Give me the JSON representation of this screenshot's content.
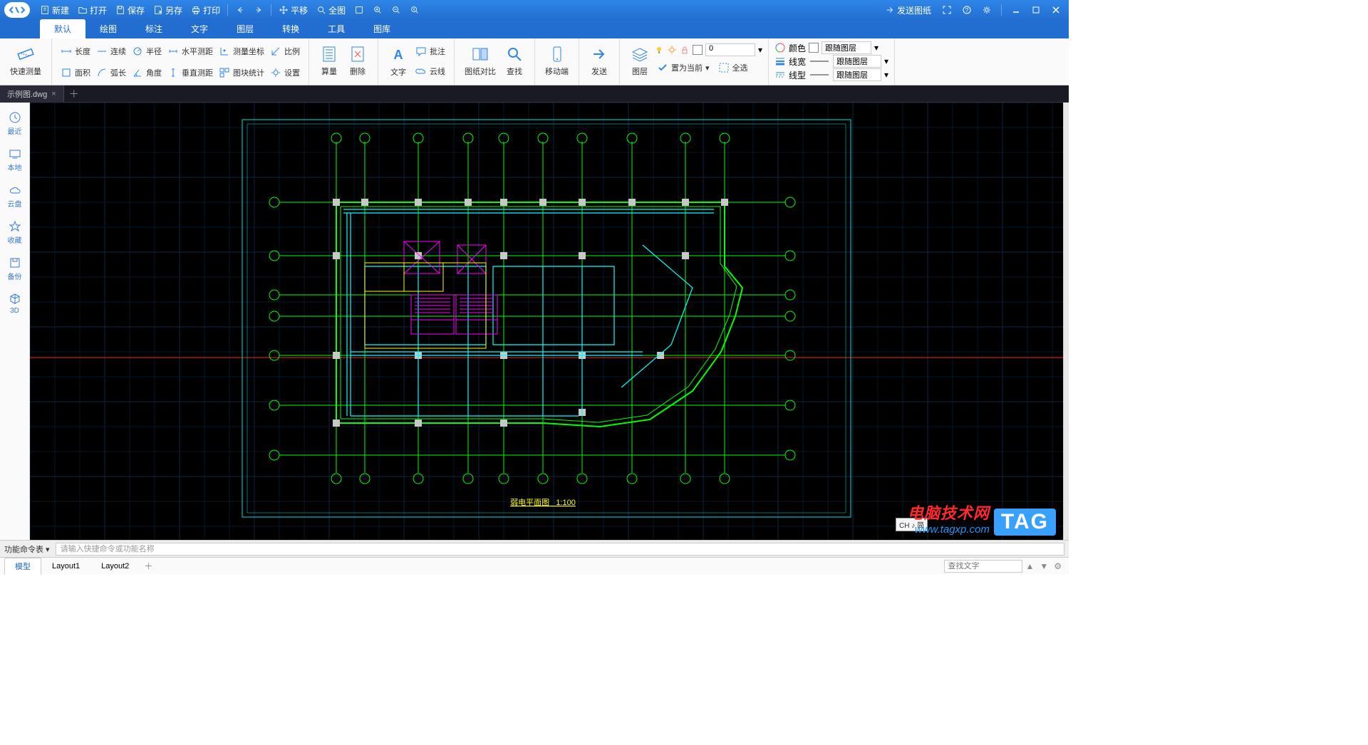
{
  "titlebar": {
    "new": "新建",
    "open": "打开",
    "save": "保存",
    "saveas": "另存",
    "print": "打印",
    "pan": "平移",
    "zoomall": "全图",
    "send_drawing": "发送图纸"
  },
  "menu": {
    "items": [
      "默认",
      "绘图",
      "标注",
      "文字",
      "图层",
      "转换",
      "工具",
      "图库"
    ],
    "active": 0
  },
  "ribbon": {
    "quick": "快速测量",
    "measure": {
      "length": "长度",
      "continuous": "连续",
      "radius": "半径",
      "hdist": "水平测距",
      "coord": "测量坐标",
      "scale": "比例",
      "area": "面积",
      "arc": "弧长",
      "angle": "角度",
      "vdist": "垂直测距",
      "blockstat": "图块统计",
      "settings": "设置"
    },
    "calc": "算量",
    "delete": "删除",
    "text": "文字",
    "annotate": "批注",
    "cloud": "云线",
    "compare": "图纸对比",
    "find": "查找",
    "mobile": "移动端",
    "send": "发送",
    "layers": "图层",
    "setcurrent": "置为当前",
    "selall": "全选",
    "props": {
      "color": "颜色",
      "weight": "线宽",
      "ltype": "线型",
      "bylayer": "跟随图层"
    },
    "counter": "0"
  },
  "doctab": {
    "name": "示例图.dwg"
  },
  "leftbar": {
    "recent": "最近",
    "local": "本地",
    "cloud": "云盘",
    "fav": "收藏",
    "backup": "备份",
    "three_d": "3D"
  },
  "drawing": {
    "title": "弱电平面图",
    "scale": "1:100"
  },
  "ime": "CH ♪ 简",
  "watermark": {
    "line1": "电脑技术网",
    "line2": "www.tagxp.com",
    "tag": "TAG"
  },
  "cmd": {
    "label": "功能命令表 ▾",
    "placeholder": "请输入快捷命令或功能名称"
  },
  "layouts": {
    "tabs": [
      "模型",
      "Layout1",
      "Layout2"
    ],
    "active": 0,
    "search_ph": "查找文字"
  }
}
